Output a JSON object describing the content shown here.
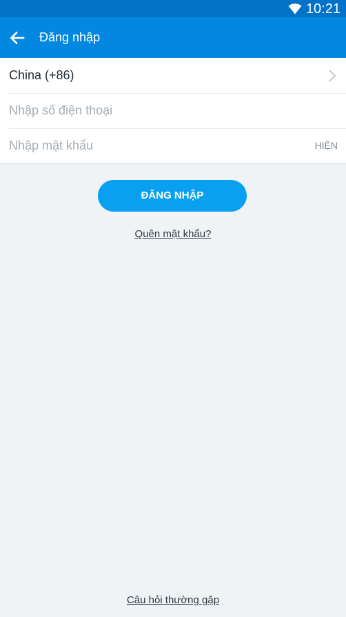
{
  "status_bar": {
    "time": "10:21",
    "wifi_icon": "wifi-icon"
  },
  "app_bar": {
    "back_icon": "arrow-left-icon",
    "title": "Đăng nhập"
  },
  "form": {
    "country": "China (+86)",
    "country_chevron_icon": "chevron-right-icon",
    "phone_placeholder": "Nhập số điện thoại",
    "password_placeholder": "Nhập mật khẩu",
    "show_password_label": "HIỆN"
  },
  "actions": {
    "login_label": "ĐĂNG NHẬP",
    "forgot_password_label": "Quên mật khẩu?",
    "faq_label": "Câu hỏi thường gặp"
  },
  "colors": {
    "status_bar": "#0272c9",
    "app_bar": "#0288e0",
    "login_button": "#0aa0f0",
    "background": "#eff3f6"
  }
}
